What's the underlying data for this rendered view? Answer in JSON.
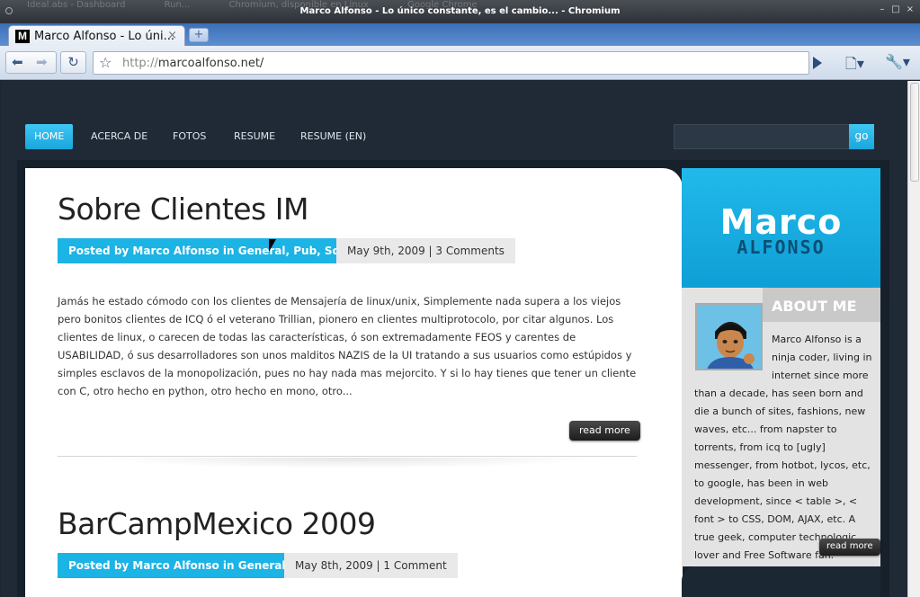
{
  "window": {
    "title": "Marco Alfonso - Lo único constante, es el cambio... - Chromium",
    "background_tabs": [
      "Ideal.abs - Dashboard",
      "Run...",
      "Chromium, disponible en Linux",
      "Google Chrome"
    ]
  },
  "tab": {
    "favicon": "M",
    "title": "Marco Alfonso - Lo úni...",
    "close": "×"
  },
  "toolbar": {
    "url_scheme": "http://",
    "url_host": "marcoalfonso.net/"
  },
  "site": {
    "nav": [
      "HOME",
      "ACERCA DE",
      "FOTOS",
      "RESUME",
      "RESUME (EN)"
    ],
    "search_button": "go",
    "accent_color": "#1cb3e5"
  },
  "posts": [
    {
      "title": "Sobre Clientes IM",
      "byline": "Posted by Marco Alfonso in General, Pub, Software",
      "date_comments": "May 9th, 2009 | 3 Comments",
      "excerpt": "Jamás he estado cómodo con los clientes de Mensajería de linux/unix, Simplemente nada supera a los viejos pero bonitos clientes de ICQ ó el veterano Trillian, pionero en clientes multiprotocolo, por citar algunos. Los clientes de linux, o carecen de todas las características, ó son extremadamente FEOS y carentes de USABILIDAD, ó sus desarrolladores son unos malditos NAZIS de la UI tratando a sus usuarios  como estúpidos y simples esclavos de la monopolización, pues no hay nada mas mejorcito. Y si lo hay tienes que tener un cliente con C, otro hecho en python, otro hecho en mono, otro...",
      "read_more": "read more"
    },
    {
      "title": "BarCampMexico 2009",
      "byline": "Posted by Marco Alfonso in General, Pub",
      "date_comments": "May 8th, 2009 | 1 Comment"
    }
  ],
  "sidebar": {
    "logo_top": "Marco",
    "logo_bottom": "ALFONSO",
    "about_title": "ABOUT ME",
    "about_text_lead": "Marco Alfonso is a ninja coder, living in internet since more",
    "about_text_rest": "than a decade, has seen born and die a bunch of sites, fashions, new waves, etc... from napster to torrents, from icq to [ugly] messenger, from hotbot, lycos, etc, to google, has been in web development, since < table >, < font > to CSS, DOM, AJAX, etc. A true geek, computer technologic lover and Free Software fan.",
    "read_more": "read more"
  }
}
